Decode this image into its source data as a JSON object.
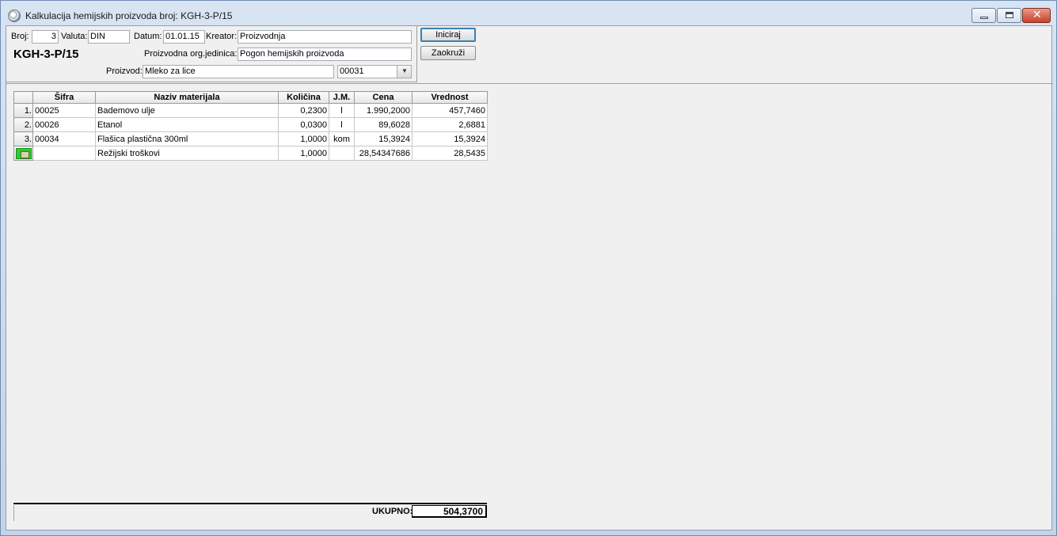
{
  "window": {
    "title": "Kalkulacija hemijskih proizvoda broj: KGH-3-P/15"
  },
  "header": {
    "broj_label": "Broj:",
    "broj_value": "3",
    "valuta_label": "Valuta:",
    "valuta_value": "DIN",
    "datum_label": "Datum:",
    "datum_value": "01.01.15",
    "kreator_label": "Kreator:",
    "kreator_value": "Proizvodnja",
    "doc_number": "KGH-3-P/15",
    "org_label": "Proizvodna org.jedinica:",
    "org_value": "Pogon hemijskih proizvoda",
    "proizvod_label": "Proizvod:",
    "proizvod_value": "Mleko za lice",
    "proizvod_code": "00031"
  },
  "buttons": {
    "iniciraj": "Iniciraj",
    "zaokruzi": "Zaokruži"
  },
  "table": {
    "columns": [
      "Šifra",
      "Naziv materijala",
      "Količina",
      "J.M.",
      "Cena",
      "Vrednost"
    ],
    "rows": [
      {
        "num": "1.",
        "sifra": "00025",
        "naziv": "Bademovo ulje",
        "kolicina": "0,2300",
        "jm": "l",
        "cena": "1.990,2000",
        "vrednost": "457,7460"
      },
      {
        "num": "2.",
        "sifra": "00026",
        "naziv": "Etanol",
        "kolicina": "0,0300",
        "jm": "l",
        "cena": "89,6028",
        "vrednost": "2,6881"
      },
      {
        "num": "3.",
        "sifra": "00034",
        "naziv": "Flašica plastična 300ml",
        "kolicina": "1,0000",
        "jm": "kom",
        "cena": "15,3924",
        "vrednost": "15,3924"
      },
      {
        "num": "",
        "sifra": "",
        "naziv": "Režijski troškovi",
        "kolicina": "1,0000",
        "jm": "",
        "cena": "28,54347686",
        "vrednost": "28,5435"
      }
    ]
  },
  "footer": {
    "total_label": "UKUPNO:",
    "total_value": "504,3700"
  }
}
